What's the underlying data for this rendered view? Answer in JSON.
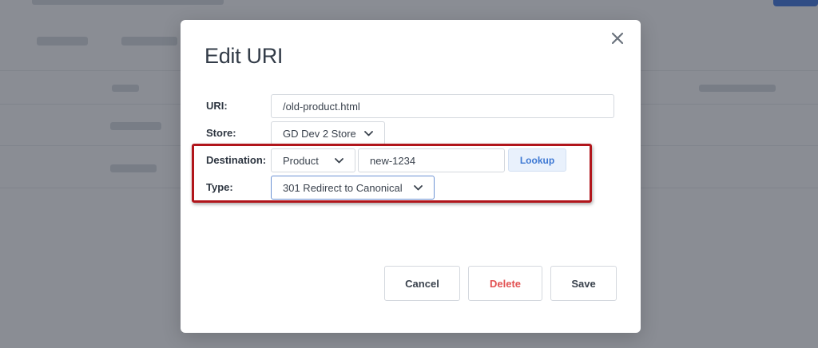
{
  "modal": {
    "title": "Edit URI",
    "close_icon": "close-icon",
    "fields": {
      "uri": {
        "label": "URI:",
        "value": "/old-product.html"
      },
      "store": {
        "label": "Store:",
        "value": "GD Dev 2 Store"
      },
      "destination": {
        "label": "Destination:",
        "type_value": "Product",
        "value": "new-1234",
        "lookup_label": "Lookup"
      },
      "type": {
        "label": "Type:",
        "value": "301 Redirect to Canonical"
      }
    },
    "buttons": {
      "cancel": "Cancel",
      "delete": "Delete",
      "save": "Save"
    }
  },
  "colors": {
    "highlight": "#b1151b",
    "accent": "#3d78d3",
    "danger": "#e25253",
    "overlay": "rgba(40, 46, 58, 0.52)"
  }
}
